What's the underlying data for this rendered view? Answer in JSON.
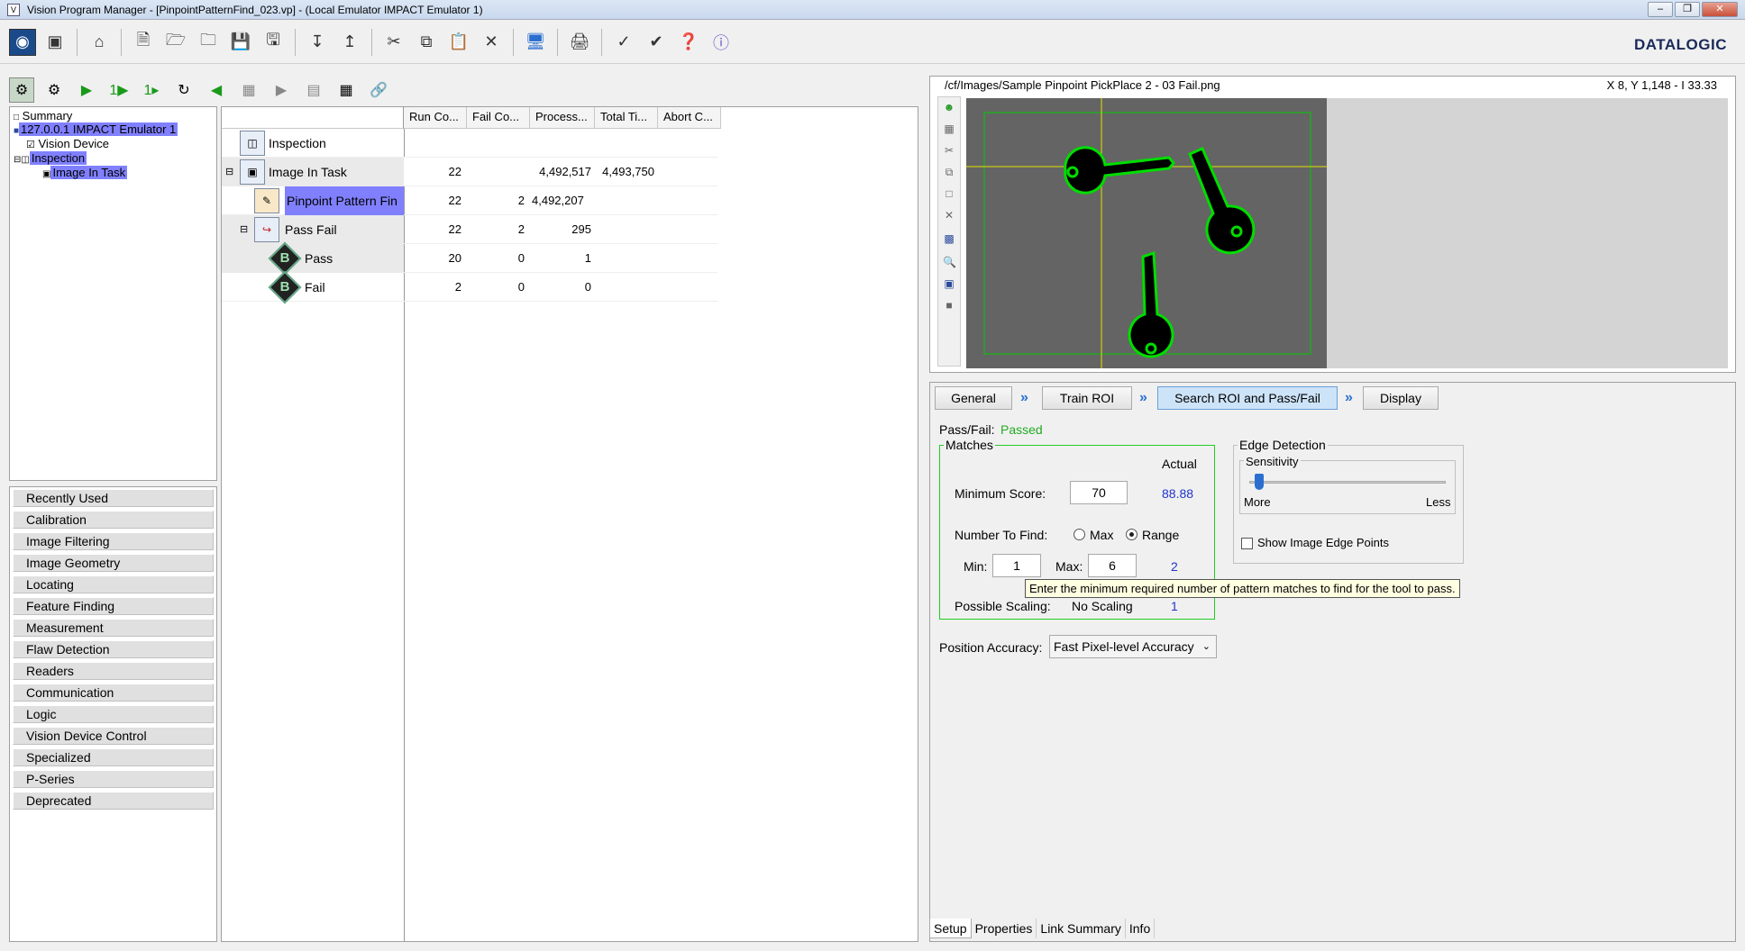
{
  "window": {
    "title": "Vision Program Manager - [PinpointPatternFind_023.vp] - (Local Emulator IMPACT Emulator 1)"
  },
  "brand": {
    "logo": "DATALOGIC"
  },
  "toolbar": {
    "icons": [
      "vision-device-icon",
      "stop-icon",
      "home-icon",
      "new-icon",
      "open-icon",
      "folder-icon",
      "save-icon",
      "save-as-icon",
      "import-icon",
      "export-icon",
      "cut-icon",
      "copy-icon",
      "paste-icon",
      "delete-icon",
      "monitor-icon",
      "print-icon",
      "check-icon",
      "check-all-icon",
      "help-icon",
      "about-icon"
    ]
  },
  "tree": {
    "items": [
      {
        "label": "Summary"
      },
      {
        "label": "127.0.0.1 IMPACT Emulator 1"
      },
      {
        "label": "Vision Device"
      },
      {
        "label": "Inspection"
      },
      {
        "label": "Image In Task"
      }
    ]
  },
  "categories": [
    "Recently Used",
    "Calibration",
    "Image Filtering",
    "Image Geometry",
    "Locating",
    "Feature Finding",
    "Measurement",
    "Flaw Detection",
    "Readers",
    "Communication",
    "Logic",
    "Vision Device Control",
    "Specialized",
    "P-Series",
    "Deprecated"
  ],
  "grid": {
    "headers": [
      "Run Co...",
      "Fail Co...",
      "Process...",
      "Total Ti...",
      "Abort C..."
    ],
    "rows": [
      {
        "name": "Inspection",
        "run": "",
        "fail": "",
        "process": "",
        "total": "",
        "abort": ""
      },
      {
        "name": "Image In Task",
        "run": "22",
        "fail": "",
        "process": "4,492,517",
        "total": "4,493,750",
        "abort": ""
      },
      {
        "name": "Pinpoint Pattern Fin",
        "run": "22",
        "fail": "2",
        "process": "4,492,207",
        "total": "",
        "abort": ""
      },
      {
        "name": "Pass Fail",
        "run": "22",
        "fail": "2",
        "process": "295",
        "total": "",
        "abort": ""
      },
      {
        "name": "Pass",
        "run": "20",
        "fail": "0",
        "process": "1",
        "total": "",
        "abort": ""
      },
      {
        "name": "Fail",
        "run": "2",
        "fail": "0",
        "process": "0",
        "total": "",
        "abort": ""
      }
    ]
  },
  "image_view": {
    "path": "/cf/Images/Sample Pinpoint PickPlace 2 - 03 Fail.png",
    "coords": "X 8,  Y 1,148  -  I 33.33"
  },
  "setup": {
    "tabs": [
      "General",
      "Train ROI",
      "Search ROI and Pass/Fail",
      "Display"
    ],
    "pass_fail_label": "Pass/Fail:",
    "pass_fail_value": "Passed",
    "matches_title": "Matches",
    "actual_header": "Actual",
    "min_score_label": "Minimum Score:",
    "min_score_value": "70",
    "min_score_actual": "88.88",
    "number_to_find_label": "Number To Find:",
    "radio_max": "Max",
    "radio_range": "Range",
    "min_label": "Min:",
    "min_value": "1",
    "max_label": "Max:",
    "max_value": "6",
    "count_actual": "2",
    "possible_scaling_label": "Possible Scaling:",
    "possible_scaling_value": "No Scaling",
    "scaling_actual": "1",
    "edge_title": "Edge Detection",
    "sensitivity_label": "Sensitivity",
    "sensitivity_level": 0.05,
    "more_label": "More",
    "less_label": "Less",
    "show_edges_label": "Show Image Edge Points",
    "position_accuracy_label": "Position Accuracy:",
    "position_accuracy_value": "Fast Pixel-level Accuracy",
    "tooltip": "Enter the minimum required number of pattern matches to find for the tool to pass."
  },
  "bottom_tabs": [
    "Setup",
    "Properties",
    "Link Summary",
    "Info"
  ],
  "colors": {
    "pass": "#22aa22",
    "actual": "#2233cc",
    "highlight": "#8080ff",
    "match_outline": "#00dd00"
  }
}
